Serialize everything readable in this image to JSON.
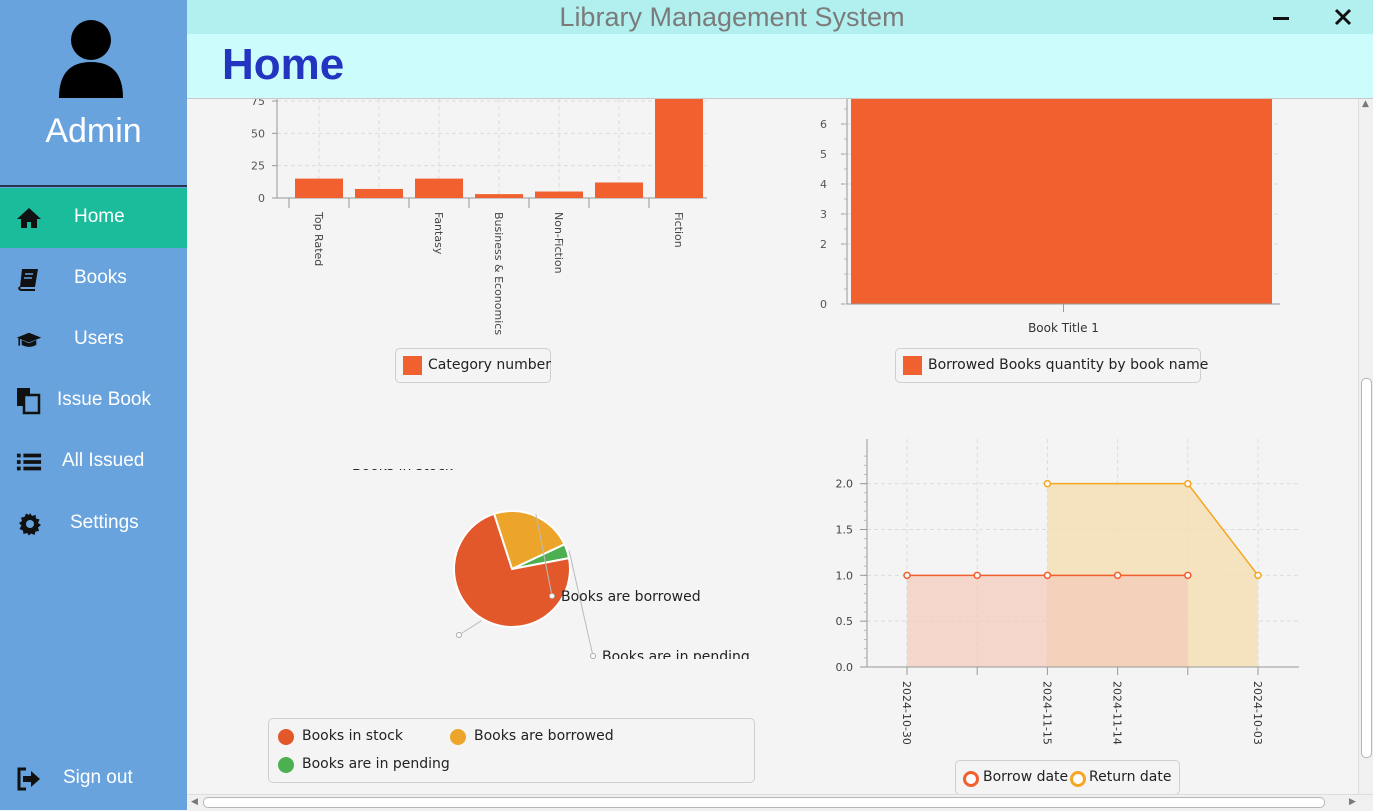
{
  "window": {
    "title": "Library Management System",
    "minimize_icon": "minimize-icon",
    "close_icon": "close-icon"
  },
  "sidebar": {
    "user_label": "Admin",
    "avatar_icon": "user-icon",
    "items": [
      {
        "label": "Home",
        "icon": "home-icon",
        "active": true
      },
      {
        "label": "Books",
        "icon": "book-icon",
        "active": false
      },
      {
        "label": "Users",
        "icon": "graduation-cap-icon",
        "active": false
      },
      {
        "label": "Issue Book",
        "icon": "copy-icon",
        "active": false
      },
      {
        "label": "All Issued",
        "icon": "list-icon",
        "active": false
      },
      {
        "label": "Settings",
        "icon": "gear-icon",
        "active": false
      }
    ],
    "signout_label": "Sign out",
    "signout_icon": "sign-out-icon"
  },
  "header": {
    "page_title": "Home"
  },
  "colors": {
    "sidebar": "#69a3dd",
    "active": "#1abc9c",
    "title_blue": "#2234c0",
    "bar": "#f16130",
    "pie_stock": "#e2582a",
    "pie_borrowed": "#eca52a",
    "pie_pending": "#4caf50",
    "line_return": "#f5a623"
  },
  "chart_data": [
    {
      "type": "bar",
      "categories": [
        "Top Rated",
        "",
        "Fantasy",
        "Business & Economics",
        "Non-Fiction",
        "",
        "Fiction"
      ],
      "values": [
        15,
        7,
        15,
        3,
        5,
        12,
        100
      ],
      "y_ticks": [
        "0",
        "25",
        "50",
        "75"
      ],
      "ylim": [
        0,
        75
      ],
      "legend": [
        "Category number"
      ],
      "grid": true
    },
    {
      "type": "bar",
      "categories": [
        "Book Title 1"
      ],
      "values": [
        7
      ],
      "y_ticks": [
        "0",
        "2",
        "3",
        "4",
        "5",
        "6"
      ],
      "ylim": [
        0,
        6.6
      ],
      "legend": [
        "Borrowed Books quantity by book name"
      ],
      "grid": true
    },
    {
      "type": "pie",
      "labels": [
        "Books in stock",
        "Books are borrowed",
        "Books are in pending"
      ],
      "values": [
        73,
        23,
        4
      ],
      "legend": [
        "Books in stock",
        "Books are borrowed",
        "Books are in pending"
      ]
    },
    {
      "type": "area",
      "categories": [
        "2024-10-30",
        "",
        "2024-11-15",
        "2024-11-14",
        "",
        "2024-10-03"
      ],
      "y_ticks": [
        "0.0",
        "0.5",
        "1.0",
        "1.5",
        "2.0"
      ],
      "ylim": [
        0,
        2.4
      ],
      "series": [
        {
          "name": "Borrow date",
          "points": [
            [
              0,
              1
            ],
            [
              1,
              1
            ],
            [
              2,
              1
            ],
            [
              3,
              1
            ],
            [
              4,
              1
            ]
          ]
        },
        {
          "name": "Return date",
          "points": [
            [
              2,
              2
            ],
            [
              4,
              2
            ],
            [
              5,
              1
            ]
          ]
        }
      ],
      "legend": [
        "Borrow date",
        "Return date"
      ],
      "grid": true
    }
  ]
}
